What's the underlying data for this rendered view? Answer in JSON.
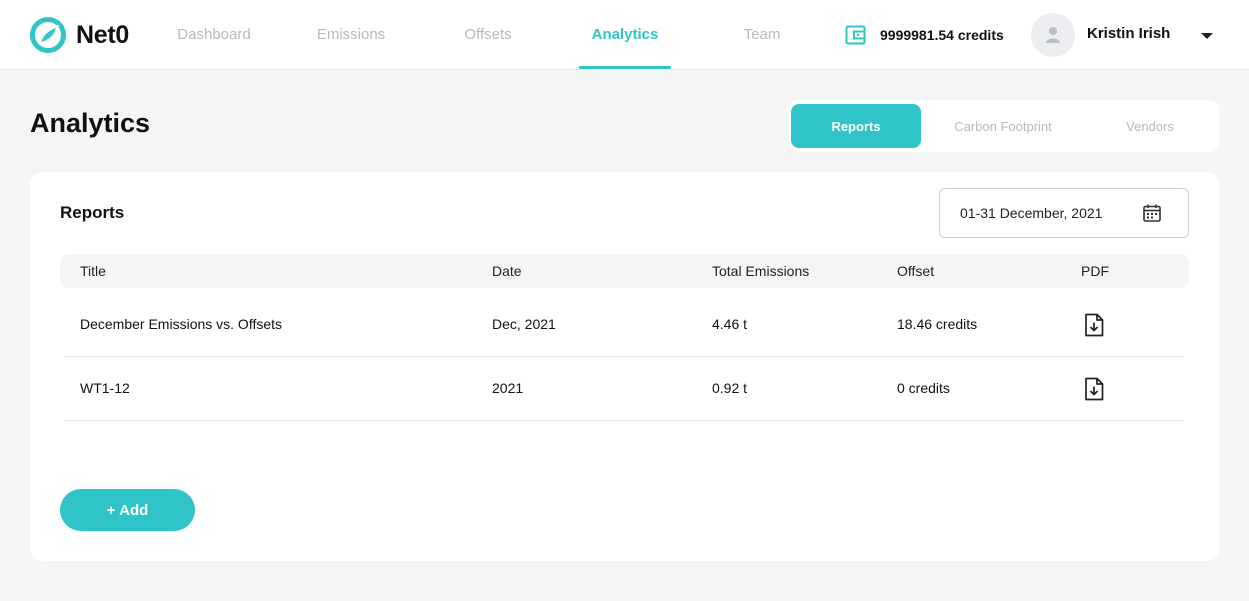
{
  "app": {
    "brand": "Net0",
    "brand_color": "#2fc5c8"
  },
  "nav": {
    "items": [
      {
        "label": "Dashboard",
        "active": false
      },
      {
        "label": "Emissions",
        "active": false
      },
      {
        "label": "Offsets",
        "active": false
      },
      {
        "label": "Analytics",
        "active": true
      },
      {
        "label": "Team",
        "active": false
      }
    ]
  },
  "account": {
    "credits": "9999981.54 credits",
    "user_name": "Kristin Irish",
    "wallet_icon": "wallet-icon",
    "avatar_icon": "user-icon"
  },
  "page": {
    "title": "Analytics",
    "tabs": [
      {
        "label": "Reports",
        "active": true
      },
      {
        "label": "Carbon Footprint",
        "active": false
      },
      {
        "label": "Vendors",
        "active": false
      }
    ]
  },
  "reports": {
    "title": "Reports",
    "date_range": "01-31 December, 2021",
    "columns": [
      "Title",
      "Date",
      "Total Emissions",
      "Offset",
      "PDF"
    ],
    "rows": [
      {
        "title": "December Emissions vs. Offsets",
        "date": "Dec, 2021",
        "emissions": "4.46 t",
        "offset": "18.46 credits"
      },
      {
        "title": "WT1-12",
        "date": "2021",
        "emissions": "0.92 t",
        "offset": "0 credits"
      }
    ],
    "add_label": "+ Add"
  }
}
